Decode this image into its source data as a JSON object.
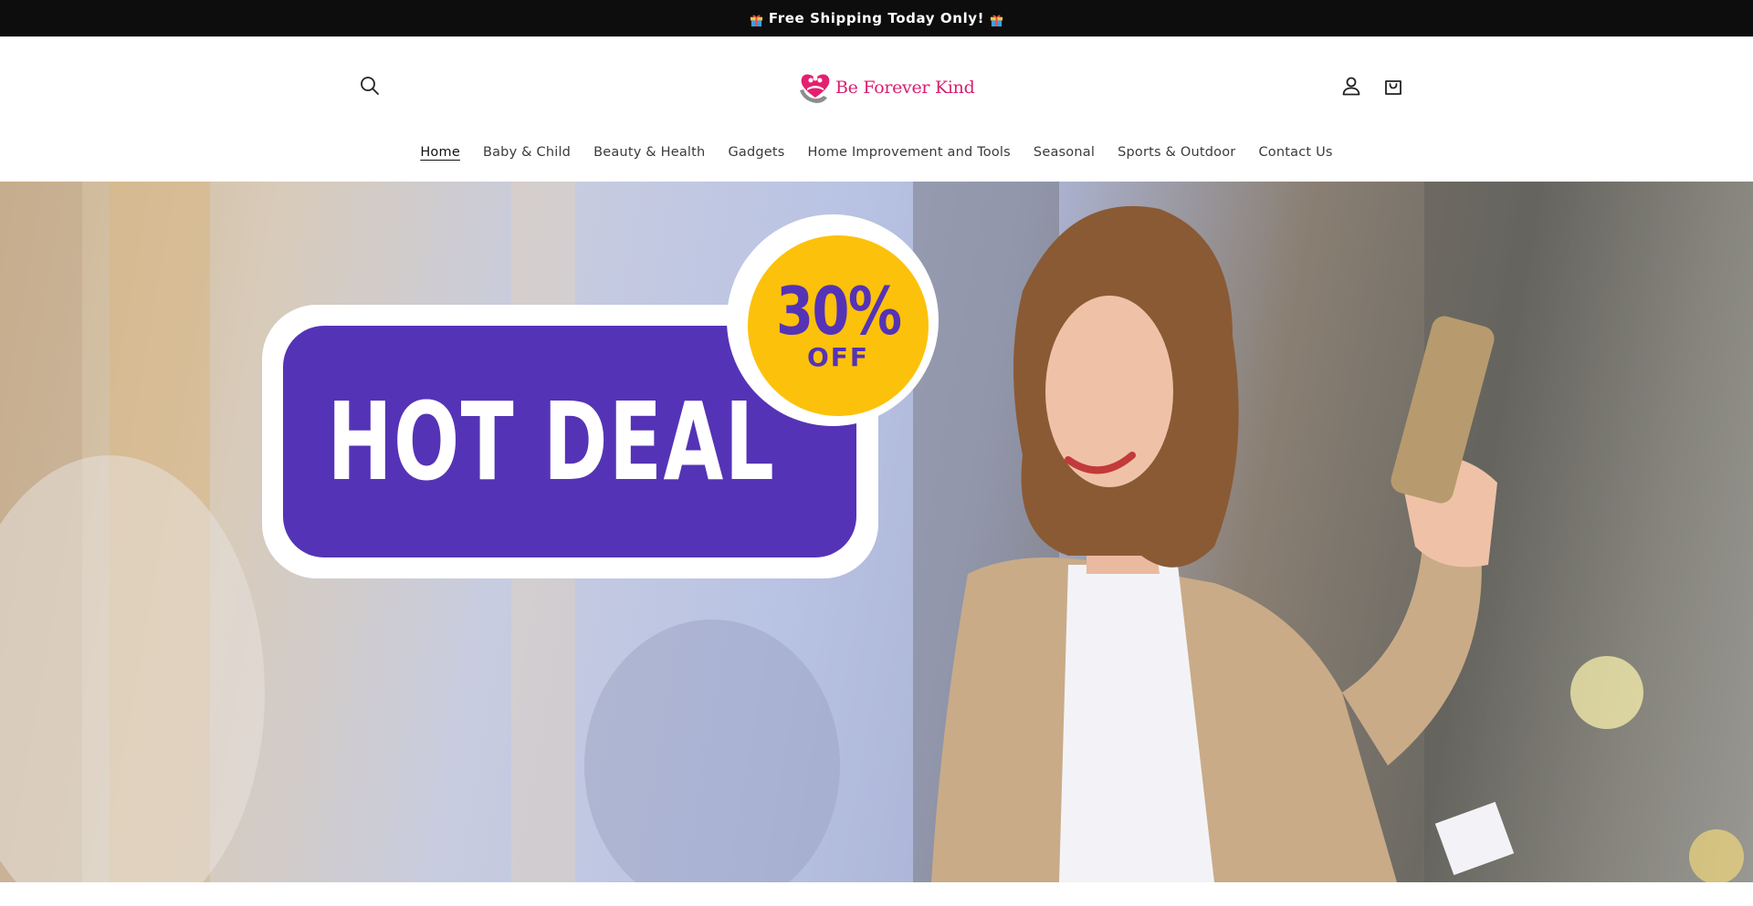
{
  "announcement": {
    "text": "Free Shipping Today Only!"
  },
  "header": {
    "logo_text": "Be Forever Kind",
    "icons": {
      "search": "search-icon",
      "account": "account-icon",
      "cart": "cart-icon"
    }
  },
  "nav": {
    "items": [
      {
        "label": "Home",
        "active": true
      },
      {
        "label": "Baby & Child"
      },
      {
        "label": "Beauty & Health"
      },
      {
        "label": "Gadgets"
      },
      {
        "label": "Home Improvement and Tools"
      },
      {
        "label": "Seasonal"
      },
      {
        "label": "Sports & Outdoor"
      },
      {
        "label": "Contact Us"
      }
    ]
  },
  "hero": {
    "badge_title": "HOT DEAL",
    "discount_percent": "30%",
    "discount_off": "OFF"
  },
  "colors": {
    "brand_pink": "#d81e6f",
    "badge_purple": "#5533b6",
    "badge_yellow": "#fcc10a",
    "announce_bg": "#0d0d0d"
  }
}
